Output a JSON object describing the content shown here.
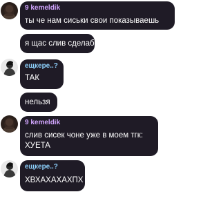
{
  "chat": {
    "messages": [
      {
        "author": "9 kemeldik",
        "author_color": "#d2a6ff",
        "lines": [
          "ты че нам сиськи свои показываешь"
        ]
      },
      {
        "author": "",
        "lines": [
          "я щас слив сделаб"
        ]
      },
      {
        "author": "ещкере..?",
        "author_color": "#8fd3ff",
        "lines": [
          "ТАК"
        ]
      },
      {
        "author": "",
        "lines": [
          "нельзя"
        ]
      },
      {
        "author": "9 kemeldik",
        "author_color": "#d2a6ff",
        "lines": [
          "слив сисек чоне уже в моем тгк:",
          "ХУЕТА"
        ]
      },
      {
        "author": "ещкере..?",
        "author_color": "#8fd3ff",
        "lines": [
          "ХВХАХАХАХПХ"
        ]
      }
    ]
  }
}
